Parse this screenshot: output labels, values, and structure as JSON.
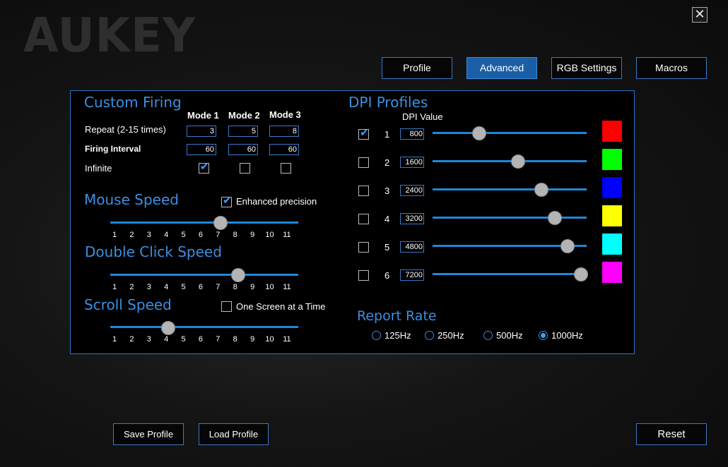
{
  "brand": "AUKEY",
  "close_symbol": "✕",
  "tabs": [
    {
      "label": "Profile"
    },
    {
      "label": "Advanced"
    },
    {
      "label": "RGB Settings"
    },
    {
      "label": "Macros"
    }
  ],
  "custom_firing": {
    "title": "Custom Firing",
    "modes": [
      "Mode 1",
      "Mode 2",
      "Mode 3"
    ],
    "repeat_label": "Repeat (2-15 times)",
    "repeat_values": [
      "3",
      "5",
      "8"
    ],
    "interval_label": "Firing Interval",
    "interval_values": [
      "60",
      "60",
      "60"
    ],
    "infinite_label": "Infinite",
    "infinite_checked": [
      true,
      false,
      false
    ]
  },
  "mouse_speed": {
    "title": "Mouse Speed",
    "enhanced_label": "Enhanced precision",
    "enhanced_checked": true,
    "value": 7,
    "ticks": [
      "1",
      "2",
      "3",
      "4",
      "5",
      "6",
      "7",
      "8",
      "9",
      "10",
      "11"
    ]
  },
  "double_click_speed": {
    "title": "Double Click Speed",
    "value": 8,
    "ticks": [
      "1",
      "2",
      "3",
      "4",
      "5",
      "6",
      "7",
      "8",
      "9",
      "10",
      "11"
    ]
  },
  "scroll_speed": {
    "title": "Scroll Speed",
    "one_screen_label": "One Screen at a Time",
    "one_screen_checked": false,
    "value": 4,
    "ticks": [
      "1",
      "2",
      "3",
      "4",
      "5",
      "6",
      "7",
      "8",
      "9",
      "10",
      "11"
    ]
  },
  "dpi_profiles": {
    "title": "DPI Profiles",
    "value_header": "DPI Value",
    "max_dpi": 7200,
    "rows": [
      {
        "index": "1",
        "checked": true,
        "value": "800",
        "color": "#ff0000"
      },
      {
        "index": "2",
        "checked": false,
        "value": "1600",
        "color": "#00ff00"
      },
      {
        "index": "3",
        "checked": false,
        "value": "2400",
        "color": "#0000ff"
      },
      {
        "index": "4",
        "checked": false,
        "value": "3200",
        "color": "#ffff00"
      },
      {
        "index": "5",
        "checked": false,
        "value": "4800",
        "color": "#00ffff"
      },
      {
        "index": "6",
        "checked": false,
        "value": "7200",
        "color": "#ff00ff"
      }
    ],
    "slider_positions": [
      0.3,
      0.55,
      0.7,
      0.79,
      0.87,
      0.96
    ]
  },
  "report_rate": {
    "title": "Report Rate",
    "options": [
      "125Hz",
      "250Hz",
      "500Hz",
      "1000Hz"
    ],
    "selected": "1000Hz"
  },
  "buttons": {
    "save": "Save Profile",
    "load": "Load Profile",
    "reset": "Reset"
  },
  "colors": {
    "accent": "#3c8fe0",
    "active_tab": "#1a5fa6",
    "slider": "#1e88d8"
  }
}
